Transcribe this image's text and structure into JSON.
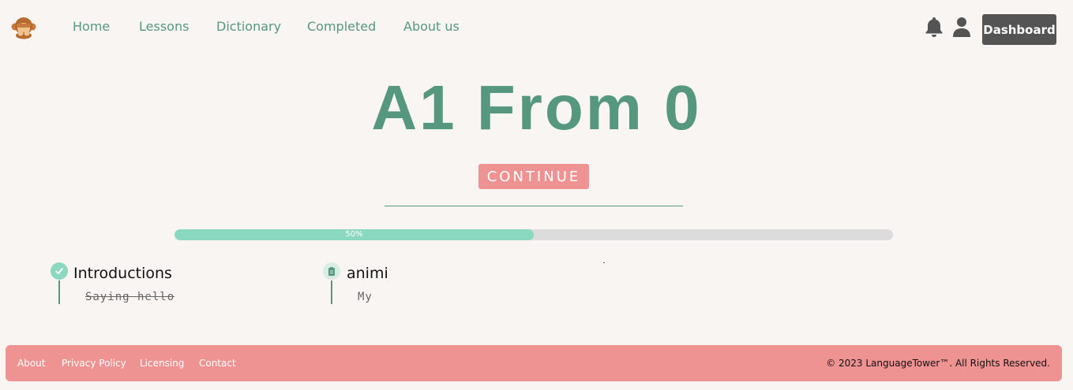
{
  "nav": {
    "logo_icon": "monkey-icon",
    "links": [
      "Home",
      "Lessons",
      "Dictionary",
      "Completed",
      "About us"
    ],
    "dashboard_label": "Dashboard",
    "bell_icon": "bell-icon",
    "user_icon": "user-icon"
  },
  "hero": {
    "title": "A1 From 0",
    "continue_label": "CONTINUE"
  },
  "progress": {
    "value": 0.5,
    "label": "50%"
  },
  "lessons": [
    {
      "title": "Introductions",
      "subtitle": "Saying hello",
      "completed": true,
      "icon": "check-icon"
    },
    {
      "title": "animi",
      "subtitle": "My",
      "completed": false,
      "icon": "clipboard-icon"
    }
  ],
  "footer": {
    "links": [
      "About",
      "Privacy Policy",
      "Licensing",
      "Contact"
    ],
    "copyright": "© 2023 LanguageTower™. All Rights Reserved."
  },
  "colors": {
    "accent_green": "#56977f",
    "progress_fill": "#89d8bf",
    "coral": "#ee9391",
    "dark_button": "#545454",
    "background": "#f9f5f3"
  }
}
